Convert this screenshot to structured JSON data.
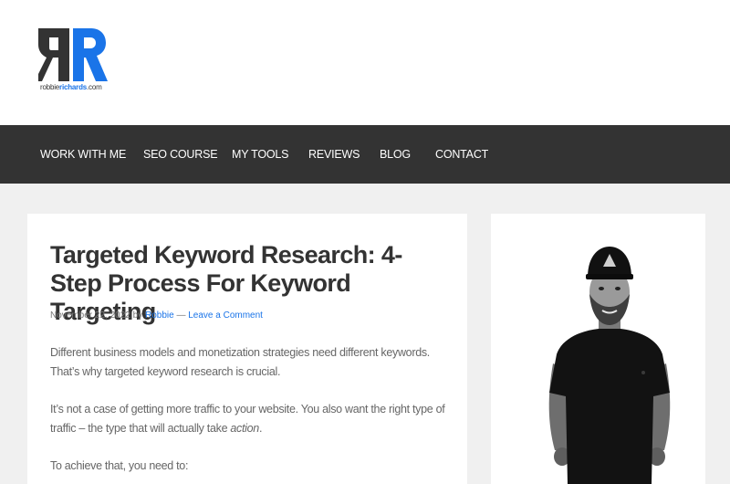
{
  "logo": {
    "text_part1": "robbie",
    "text_part2": "richards",
    "text_part3": ".com"
  },
  "nav": {
    "items": [
      {
        "label": "WORK WITH ME"
      },
      {
        "label": "SEO COURSE"
      },
      {
        "label": "MY TOOLS"
      },
      {
        "label": "REVIEWS"
      },
      {
        "label": "BLOG"
      },
      {
        "label": "CONTACT"
      }
    ]
  },
  "post": {
    "title": "Targeted Keyword Research: 4-Step Process For Keyword Targeting",
    "date": "November 22, 2022",
    "by": "by",
    "author": "Robbie",
    "separator": "—",
    "comment_link": "Leave a Comment",
    "p1": "Different business models and monetization strategies need different keywords. That’s why targeted keyword research is crucial.",
    "p2_text": "It’s not a case of getting more traffic to your website. You also want the right type of traffic – the type that will actually take",
    "p2_em": "action",
    "p2_end": ".",
    "p3": "To achieve that, you need to:"
  },
  "colors": {
    "nav_bg": "#333333",
    "accent": "#1a74e8",
    "page_bg": "#f0f0f0"
  }
}
